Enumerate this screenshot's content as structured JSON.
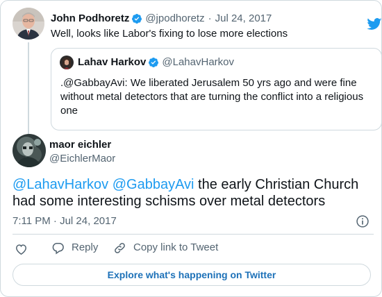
{
  "parent_tweet": {
    "author_name": "John Podhoretz",
    "author_handle": "@jpodhoretz",
    "separator": "·",
    "date": "Jul 24, 2017",
    "text": "Well, looks like Labor's fixing to lose more elections",
    "quoted_tweet": {
      "author_name": "Lahav Harkov",
      "author_handle": "@LahavHarkov",
      "text": ".@GabbayAvi: We liberated Jerusalem 50 yrs ago and were fine without metal detectors that are turning the conflict into a religious one"
    }
  },
  "main_tweet": {
    "author_name": "maor eichler",
    "author_handle": "@EichlerMaor",
    "mention_1": "@LahavHarkov",
    "mention_2": "@GabbayAvi",
    "text_rest": " the early Christian Church had some interesting schisms over metal detectors",
    "time": "7:11 PM",
    "separator": "·",
    "date": "Jul 24, 2017"
  },
  "actions": {
    "reply_label": "Reply",
    "copy_label": "Copy link to Tweet"
  },
  "explore_label": "Explore what's happening on Twitter",
  "colors": {
    "accent_blue": "#1d9bf0",
    "text": "#0f1419",
    "muted": "#536471",
    "border": "#cfd9de"
  },
  "icons": [
    "twitter-bird-icon",
    "verified-badge-icon",
    "info-icon",
    "heart-icon",
    "reply-icon",
    "link-icon"
  ]
}
